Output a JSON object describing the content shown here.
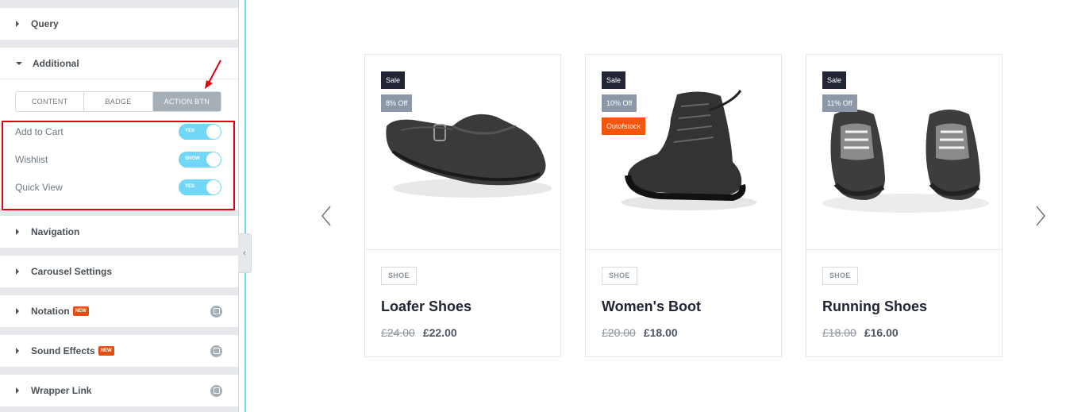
{
  "sidebar": {
    "sections": {
      "query": "Query",
      "additional": "Additional",
      "navigation": "Navigation",
      "carousel": "Carousel Settings",
      "notation": "Notation",
      "sound": "Sound Effects",
      "wrapper": "Wrapper Link"
    },
    "new_badge": "NEW",
    "tabs": [
      "CONTENT",
      "BADGE",
      "ACTION BTN"
    ],
    "active_tab": "ACTION BTN",
    "controls": [
      {
        "label": "Add to Cart",
        "state": "YES"
      },
      {
        "label": "Wishlist",
        "state": "SHOW"
      },
      {
        "label": "Quick View",
        "state": "YES"
      }
    ],
    "colors": {
      "accent_toggle": "#71d7f7",
      "highlight_box": "#e10012",
      "new_badge": "#e54e13"
    }
  },
  "products": [
    {
      "title": "Loafer Shoes",
      "category": "SHOE",
      "old_price": "£24.00",
      "new_price": "£22.00",
      "badges": [
        "Sale",
        "8% Off"
      ],
      "image_icon": "loafer-shoe-image"
    },
    {
      "title": "Women's Boot",
      "category": "SHOE",
      "old_price": "£20.00",
      "new_price": "£18.00",
      "badges": [
        "Sale",
        "10% Off",
        "Outofstock"
      ],
      "image_icon": "boot-image"
    },
    {
      "title": "Running Shoes",
      "category": "SHOE",
      "old_price": "£18.00",
      "new_price": "£16.00",
      "badges": [
        "Sale",
        "11% Off"
      ],
      "image_icon": "running-shoes-image"
    }
  ],
  "carousel": {
    "prev_icon": "chevron-left-icon",
    "next_icon": "chevron-right-icon"
  }
}
